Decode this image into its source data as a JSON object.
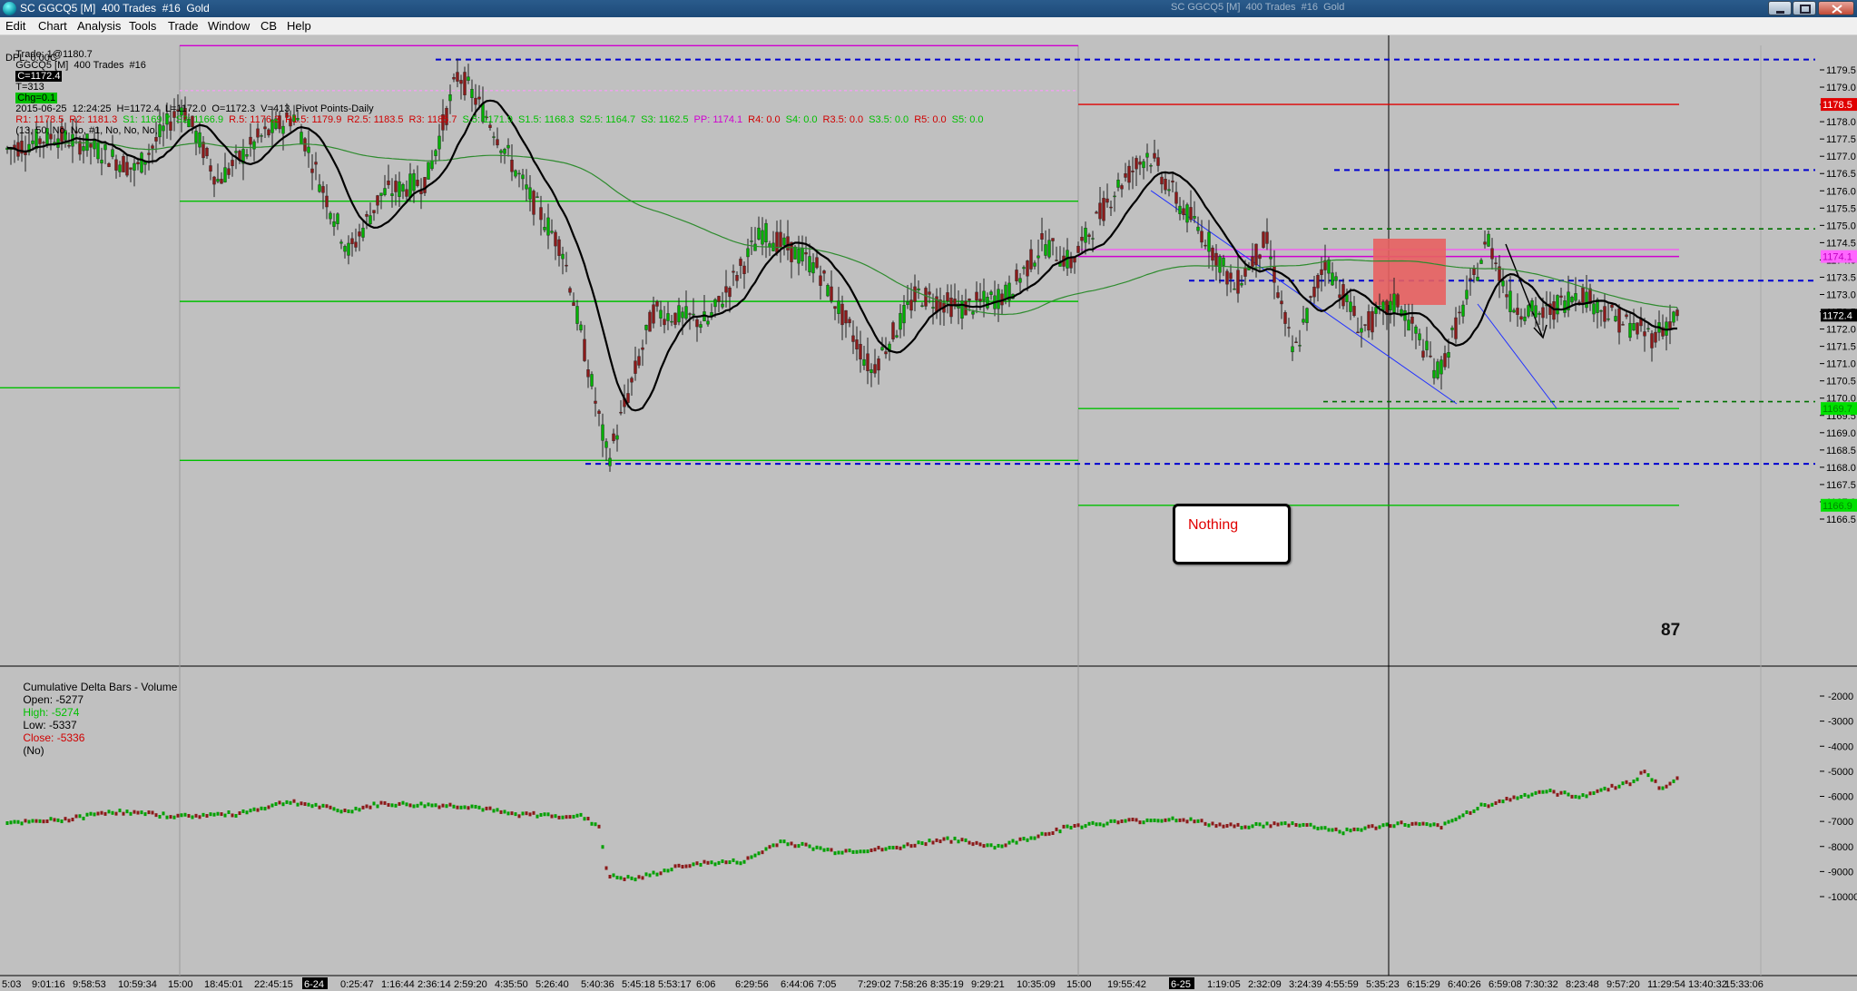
{
  "window": {
    "title": "SC GGCQ5 [M]  400 Trades  #16  Gold",
    "ghost_title": "SC GGCQ5 [M]  400 Trades  #16  Gold"
  },
  "menu": {
    "items": [
      "Edit",
      "Chart",
      "Analysis",
      "Tools",
      "Trade",
      "Window",
      "CB",
      "Help"
    ]
  },
  "header": {
    "trade": "Trade: 1@1180.7",
    "symbol": "GGCQ5 [M]  400 Trades  #16",
    "close_box": "C=1172.4",
    "t_value": "T=313",
    "chg_box": "Chg=0.1",
    "datetime_ohlc": "2015-06-25  12:24:25  H=1172.4  L=1172.0  O=1172.3  V=413  Pivot Points-Daily",
    "pivots": [
      {
        "text": "R1: 1178.5",
        "color": "#d00000"
      },
      {
        "text": "R2: 1181.3",
        "color": "#d00000"
      },
      {
        "text": "S1: 1169.7",
        "color": "#00c000"
      },
      {
        "text": "S2: 1166.9",
        "color": "#00c000"
      },
      {
        "text": "R.5: 1176.3",
        "color": "#d00000"
      },
      {
        "text": "R1.5: 1179.9",
        "color": "#d00000"
      },
      {
        "text": "R2.5: 1183.5",
        "color": "#d00000"
      },
      {
        "text": "R3: 1185.7",
        "color": "#d00000"
      },
      {
        "text": "S.5: 1171.9",
        "color": "#00c000"
      },
      {
        "text": "S1.5: 1168.3",
        "color": "#00c000"
      },
      {
        "text": "S2.5: 1164.7",
        "color": "#00c000"
      },
      {
        "text": "S3: 1162.5",
        "color": "#00c000"
      },
      {
        "text": "PP: 1174.1",
        "color": "#d000d0"
      },
      {
        "text": "R4: 0.0",
        "color": "#d00000"
      },
      {
        "text": "S4: 0.0",
        "color": "#00c000"
      },
      {
        "text": "R3.5: 0.0",
        "color": "#d00000"
      },
      {
        "text": "S3.5: 0.0",
        "color": "#00c000"
      },
      {
        "text": "R5: 0.0",
        "color": "#d00000"
      },
      {
        "text": "S5: 0.0",
        "color": "#00c000"
      }
    ],
    "tail": "(13, 50, No, No, #1, No, No, No,",
    "dpl": "DPL: 0.00C"
  },
  "price_axis": {
    "ticks": [
      1179.5,
      1179.0,
      1178.5,
      1178.0,
      1177.5,
      1177.0,
      1176.5,
      1176.0,
      1175.5,
      1175.0,
      1174.5,
      1174.0,
      1173.5,
      1173.0,
      1172.5,
      1172.0,
      1171.5,
      1171.0,
      1170.5,
      1170.0,
      1169.5,
      1169.0,
      1168.5,
      1168.0,
      1167.5,
      1167.0,
      1166.5
    ],
    "current_price": "1172.4",
    "r1_label": "1178.5",
    "pp_label": "1174.1",
    "s1_label": "1169.7",
    "s2_label": "1166.9",
    "colors": {
      "r1": "#e00000",
      "pp": "#ff66ff",
      "s": "#00e000",
      "current": "#000000"
    }
  },
  "lower_panel": {
    "title": "Cumulative Delta Bars - Volume",
    "open": "Open: -5277",
    "high": "High: -5274",
    "low": "Low: -5337",
    "close": "Close: -5336",
    "flag": "(No)",
    "axis_ticks": [
      -2000,
      -3000,
      -4000,
      -5000,
      -6000,
      -7000,
      -8000,
      -9000,
      -10000
    ]
  },
  "time_axis": {
    "labels": [
      "5:03",
      "9:01:16",
      "9:58:53",
      "10:59:34",
      "15:00",
      "18:45:01",
      "22:45:15",
      "6-24",
      "0:25:47",
      "1:16:44",
      "2:36:14",
      "2:59:20",
      "4:35:50",
      "5:26:40",
      "5:40:36",
      "5:45:18",
      "5:53:17",
      "6:06",
      "6:29:56",
      "6:44:06",
      "7:05",
      "7:29:02",
      "7:58:26",
      "8:35:19",
      "9:29:21",
      "10:35:09",
      "15:00",
      "19:55:42",
      "6-25",
      "1:19:05",
      "2:32:09",
      "3:24:39",
      "4:55:59",
      "5:35:23",
      "6:15:29",
      "6:40:26",
      "6:59:08",
      "7:30:32",
      "8:23:48",
      "9:57:20",
      "11:29:54",
      "13:40:32",
      "15:33:06"
    ],
    "date_labels": [
      "6-24",
      "6-25"
    ]
  },
  "annotations": {
    "nothing_label": "Nothing",
    "count_label": "87",
    "box_color": "#e86060"
  }
}
